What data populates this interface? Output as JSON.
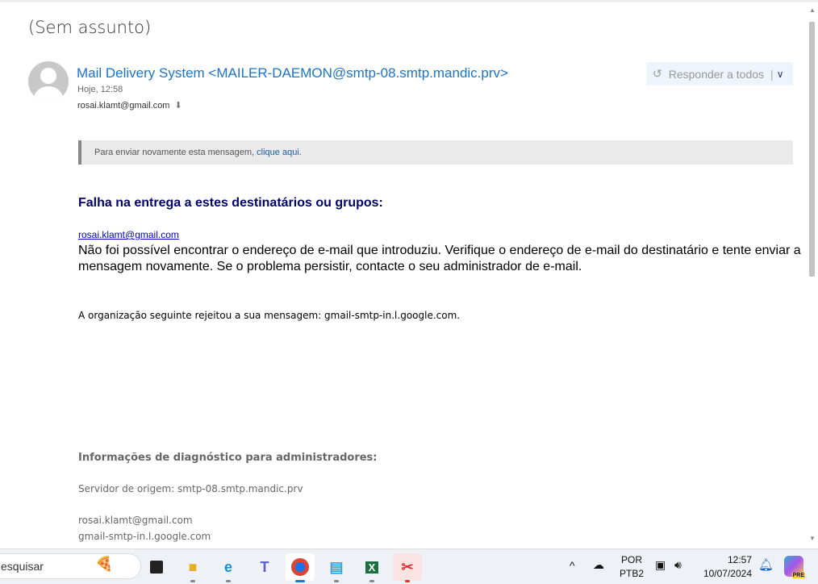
{
  "email": {
    "subject": "(Sem assunto)",
    "from": "Mail Delivery System <MAILER-DAEMON@smtp-08.smtp.mandic.prv>",
    "date": "Hoje, 12:58",
    "to": "rosai.klamt@gmail.com",
    "reply_all_label": "Responder a todos",
    "notice_text": "Para enviar novamente esta mensagem, ",
    "notice_link": "clique aqui",
    "notice_end": ".",
    "fail_title": "Falha na entrega a estes destinatários ou grupos:",
    "recipient": "rosai.klamt@gmail.com",
    "message": "Não foi possível encontrar o endereço de e-mail que introduziu. Verifique o endereço de e-mail do destinatário e tente enviar a mensagem novamente. Se o problema persistir, contacte o seu administrador de e-mail.",
    "org_rejected": "A organização seguinte rejeitou a sua mensagem: gmail-smtp-in.l.google.com.",
    "diag_title": "Informações de diagnóstico para administradores:",
    "origin_server": "Servidor de origem: smtp-08.smtp.mandic.prv",
    "diag_recipient": "rosai.klamt@gmail.com",
    "diag_host": "gmail-smtp-in.l.google.com"
  },
  "taskbar": {
    "search_placeholder": "esquisar",
    "apps": [
      "Task View",
      "File Explorer",
      "Edge",
      "Teams",
      "Chrome",
      "Notepad",
      "Excel",
      "Snipping Tool"
    ],
    "lang": "POR",
    "layout": "PTB2",
    "time": "12:57",
    "date": "10/07/2024",
    "copilot_badge": "PRE"
  }
}
